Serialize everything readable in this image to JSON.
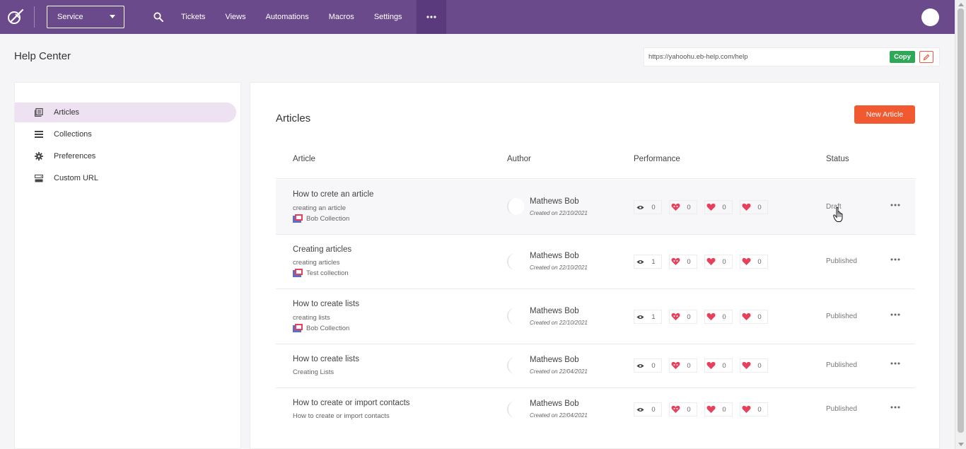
{
  "topbar": {
    "department": "Service",
    "nav": [
      "Tickets",
      "Views",
      "Automations",
      "Macros",
      "Settings"
    ]
  },
  "page": {
    "title": "Help Center",
    "url": "https://yahoohu.eb-help.com/help",
    "copy_label": "Copy"
  },
  "sidebar": {
    "items": [
      {
        "label": "Articles",
        "icon": "articles-icon",
        "active": true
      },
      {
        "label": "Collections",
        "icon": "collections-icon",
        "active": false
      },
      {
        "label": "Preferences",
        "icon": "gear-icon",
        "active": false
      },
      {
        "label": "Custom URL",
        "icon": "server-icon",
        "active": false
      }
    ]
  },
  "main": {
    "title": "Articles",
    "new_button": "New Article",
    "columns": [
      "Article",
      "Author",
      "Performance",
      "Status"
    ],
    "rows": [
      {
        "title": "How to crete an article",
        "subtitle": "creating an article",
        "collection": "Bob Collection",
        "author": "Mathews Bob",
        "created": "Created on 22/10/2021",
        "views": "0",
        "love": "0",
        "like": "0",
        "favorite": "0",
        "status": "Draft"
      },
      {
        "title": "Creating articles",
        "subtitle": "creating articles",
        "collection": "Test collection",
        "author": "Mathews Bob",
        "created": "Created on 22/10/2021",
        "views": "1",
        "love": "0",
        "like": "0",
        "favorite": "0",
        "status": "Published"
      },
      {
        "title": "How to create lists",
        "subtitle": "creating lists",
        "collection": "Bob Collection",
        "author": "Mathews Bob",
        "created": "Created on 22/10/2021",
        "views": "1",
        "love": "0",
        "like": "0",
        "favorite": "0",
        "status": "Published"
      },
      {
        "title": "How to create lists",
        "subtitle": "Creating Lists",
        "collection": "",
        "author": "Mathews Bob",
        "created": "Created on 22/04/2021",
        "views": "0",
        "love": "0",
        "like": "0",
        "favorite": "0",
        "status": "Published"
      },
      {
        "title": "How to create or import contacts",
        "subtitle": "How to create or import contacts",
        "collection": "",
        "author": "Mathews Bob",
        "created": "Created on 22/04/2021",
        "views": "0",
        "love": "0",
        "like": "0",
        "favorite": "0",
        "status": "Published"
      }
    ]
  },
  "colors": {
    "brand": "#6b4a8c",
    "accent": "#f15a31",
    "copy": "#2ea857",
    "heart": "#e8405a"
  }
}
